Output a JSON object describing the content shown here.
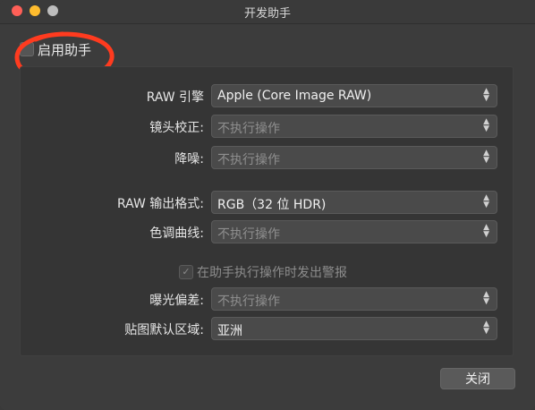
{
  "window": {
    "title": "开发助手"
  },
  "enable": {
    "label": "启用助手",
    "checked": false
  },
  "rows": [
    {
      "label": "RAW 引擎",
      "value": "Apple (Core Image RAW)",
      "enabled": true
    },
    {
      "label": "镜头校正:",
      "value": "不执行操作",
      "enabled": false
    },
    {
      "label": "降噪:",
      "value": "不执行操作",
      "enabled": false
    },
    {
      "label": "RAW 输出格式:",
      "value": "RGB（32 位 HDR)",
      "enabled": true
    },
    {
      "label": "色调曲线:",
      "value": "不执行操作",
      "enabled": false
    },
    {
      "label": "曝光偏差:",
      "value": "不执行操作",
      "enabled": false
    },
    {
      "label": "贴图默认区域:",
      "value": "亚洲",
      "enabled": true
    }
  ],
  "warn": {
    "label": "在助手执行操作时发出警报",
    "checked": true
  },
  "buttons": {
    "close": "关闭"
  },
  "colors": {
    "annotation": "#ff3b1f"
  }
}
